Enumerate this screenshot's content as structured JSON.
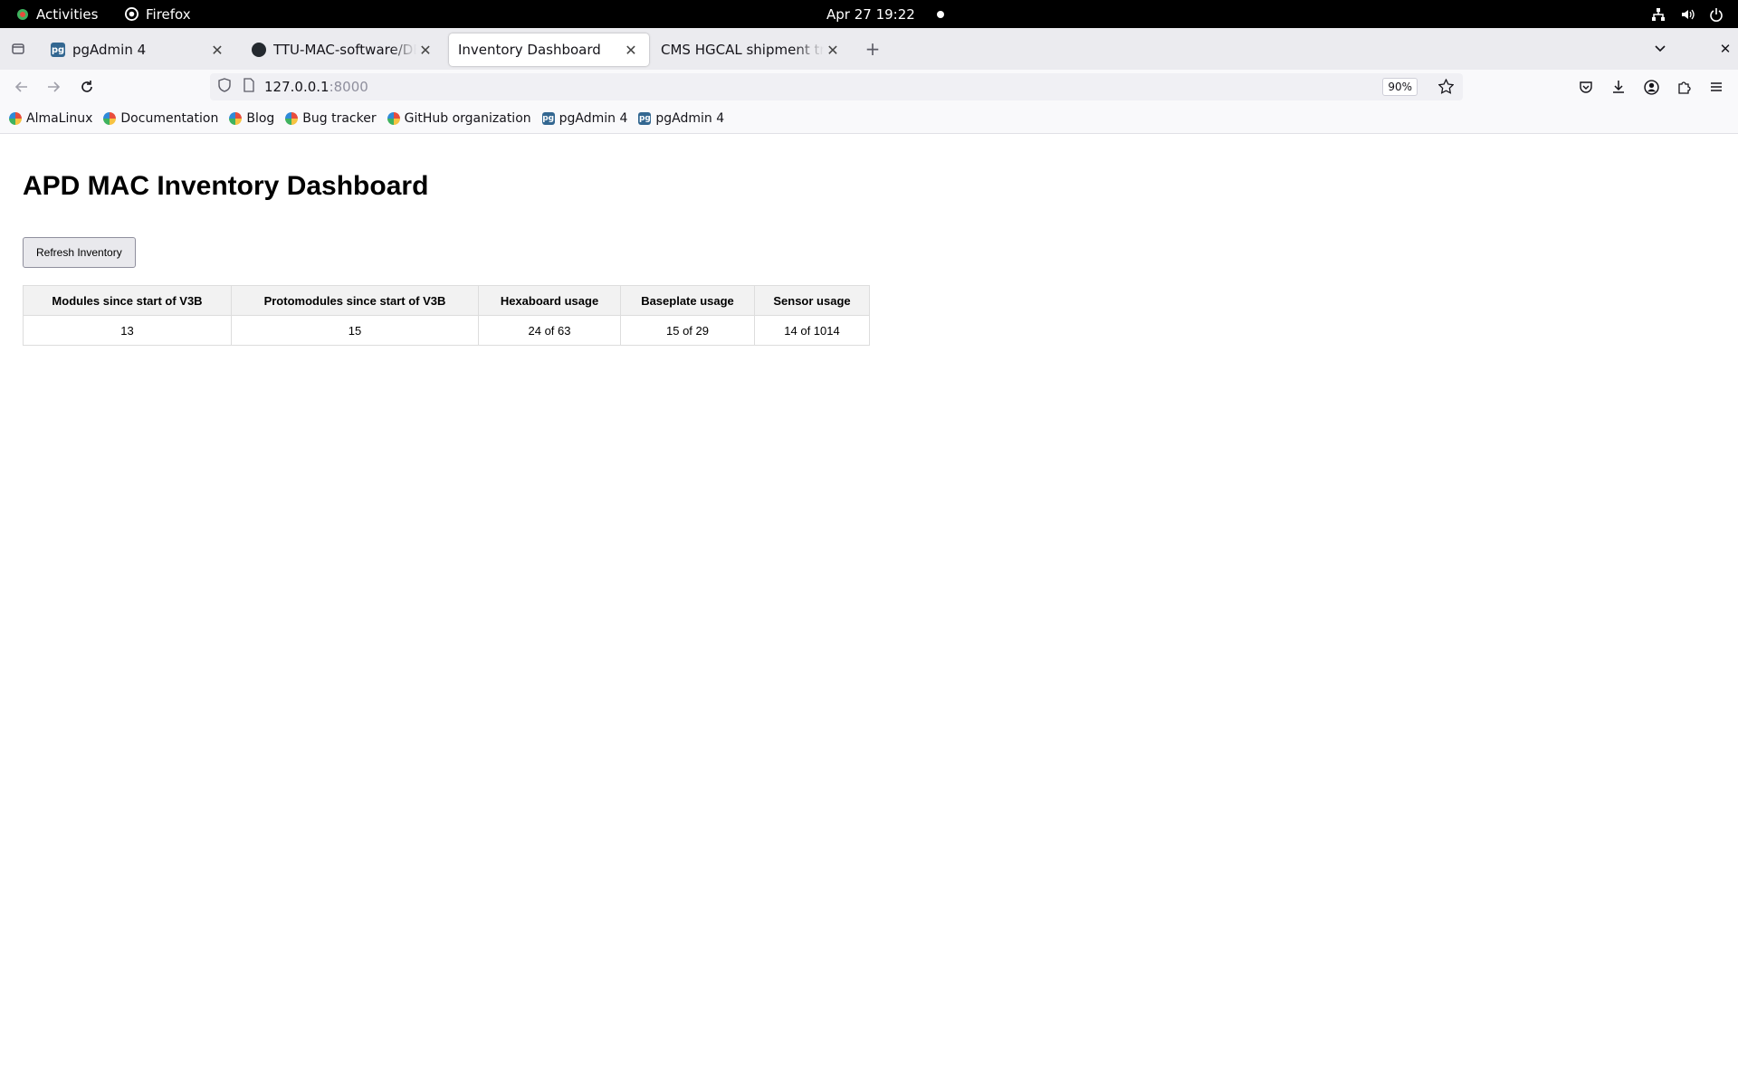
{
  "system": {
    "activities": "Activities",
    "app_name": "Firefox",
    "clock": "Apr 27  19:22"
  },
  "tabs": [
    {
      "title": "pgAdmin 4",
      "icon": "pgadmin-icon",
      "active": false
    },
    {
      "title": "TTU-MAC-software/DBtools",
      "icon": "github-icon",
      "active": false
    },
    {
      "title": "Inventory Dashboard",
      "icon": "",
      "active": true
    },
    {
      "title": "CMS HGCAL shipment tracking",
      "icon": "",
      "active": false
    }
  ],
  "navbar": {
    "url_host": "127.0.0.1",
    "url_port": ":8000",
    "zoom": "90%"
  },
  "bookmarks": [
    {
      "label": "AlmaLinux",
      "icon": "almalinux-icon"
    },
    {
      "label": "Documentation",
      "icon": "almalinux-icon"
    },
    {
      "label": "Blog",
      "icon": "almalinux-icon"
    },
    {
      "label": "Bug tracker",
      "icon": "almalinux-icon"
    },
    {
      "label": "GitHub organization",
      "icon": "almalinux-icon"
    },
    {
      "label": "pgAdmin 4",
      "icon": "pgadmin-icon"
    },
    {
      "label": "pgAdmin 4",
      "icon": "pgadmin-icon"
    }
  ],
  "page": {
    "title": "APD MAC Inventory Dashboard",
    "refresh_label": "Refresh Inventory",
    "table": {
      "headers": [
        "Modules since start of V3B",
        "Protomodules since start of V3B",
        "Hexaboard usage",
        "Baseplate usage",
        "Sensor usage"
      ],
      "rows": [
        [
          "13",
          "15",
          "24 of 63",
          "15 of 29",
          "14 of 1014"
        ]
      ]
    }
  },
  "colors": {
    "topbar_bg": "#000000",
    "tabstrip_bg": "#ebebef",
    "table_header_bg": "#f2f2f2",
    "button_bg": "#e9e9ed"
  }
}
